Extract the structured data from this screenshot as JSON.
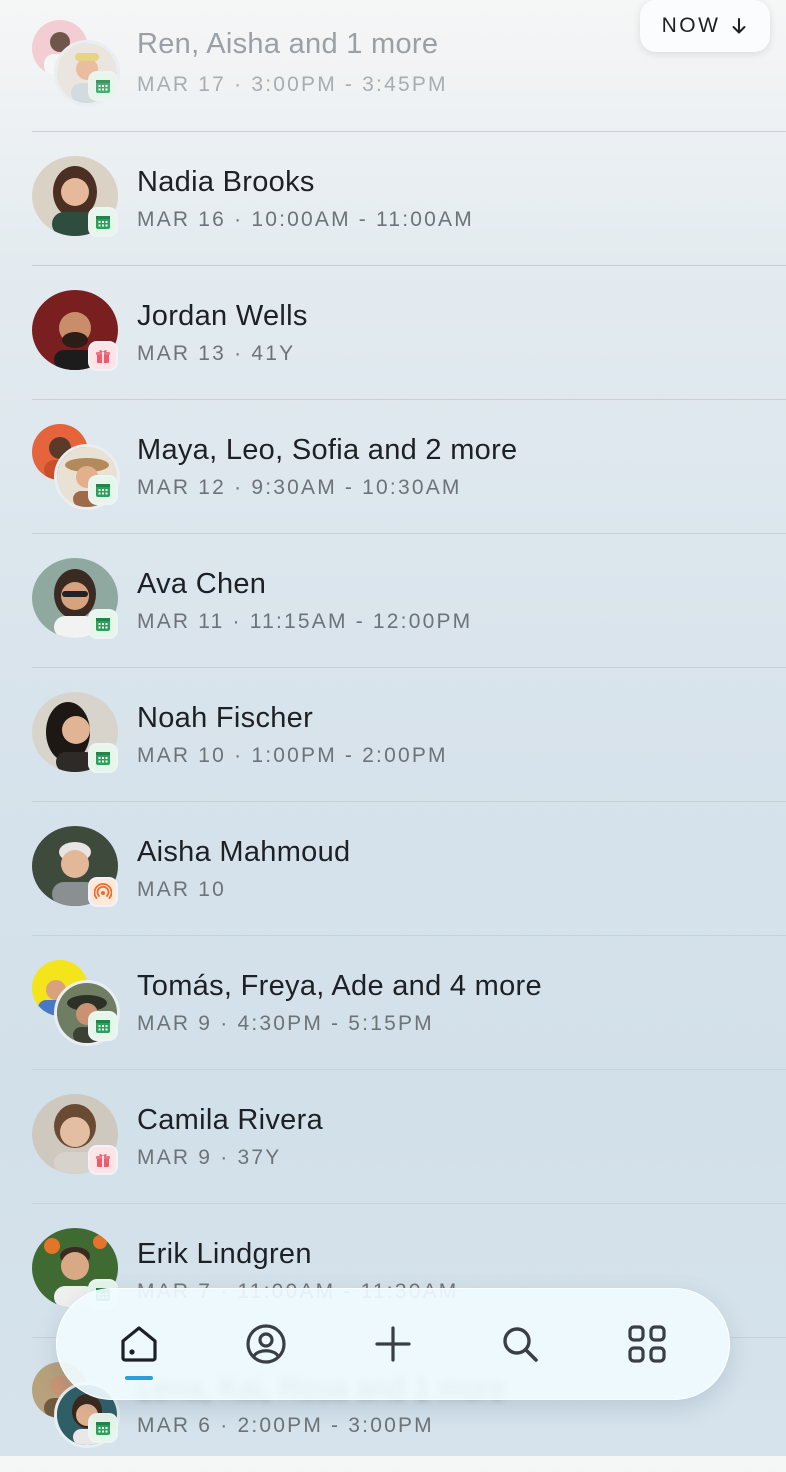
{
  "now_button": {
    "label": "NOW"
  },
  "events": [
    {
      "name": "Ren, Aisha and 1 more",
      "meta": "MAR 17 · 3:00PM - 3:45PM",
      "badge": "calendar-icon",
      "group": true
    },
    {
      "name": "Nadia Brooks",
      "meta": "MAR 16 · 10:00AM - 11:00AM",
      "badge": "calendar-icon",
      "group": false
    },
    {
      "name": "Jordan Wells",
      "meta": "MAR 13 · 41Y",
      "badge": "gift-icon",
      "group": false
    },
    {
      "name": "Maya, Leo, Sofia and 2 more",
      "meta": "MAR 12 · 9:30AM - 10:30AM",
      "badge": "calendar-icon",
      "group": true
    },
    {
      "name": "Ava Chen",
      "meta": "MAR 11 · 11:15AM - 12:00PM",
      "badge": "calendar-icon",
      "group": false
    },
    {
      "name": "Noah Fischer",
      "meta": "MAR 10 · 1:00PM - 2:00PM",
      "badge": "calendar-icon",
      "group": false
    },
    {
      "name": "Aisha Mahmoud",
      "meta": "MAR 10",
      "badge": "broadcast-icon",
      "group": false
    },
    {
      "name": "Tomás, Freya, Ade and 4 more",
      "meta": "MAR 9 · 4:30PM - 5:15PM",
      "badge": "calendar-icon",
      "group": true
    },
    {
      "name": "Camila Rivera",
      "meta": "MAR 9 · 37Y",
      "badge": "gift-icon",
      "group": false
    },
    {
      "name": "Erik Lindgren",
      "meta": "MAR 7 · 11:00AM - 11:30AM",
      "badge": "calendar-icon",
      "group": false
    },
    {
      "name": "Lena, Kai, Rosa and 1 more",
      "meta": "MAR 6 · 2:00PM - 3:00PM",
      "badge": "calendar-icon",
      "group": true
    }
  ],
  "tab_bar": {
    "tabs": [
      {
        "icon": "home-icon",
        "active": true
      },
      {
        "icon": "profile-icon",
        "active": false
      },
      {
        "icon": "plus-icon",
        "active": false
      },
      {
        "icon": "search-icon",
        "active": false
      },
      {
        "icon": "grid-icon",
        "active": false
      }
    ],
    "accent": "#2a9fd8"
  },
  "colors": {
    "calendar_badge": "#e6f6ea",
    "gift_badge": "#fde4e7",
    "broadcast_badge": "#fde8d9"
  }
}
